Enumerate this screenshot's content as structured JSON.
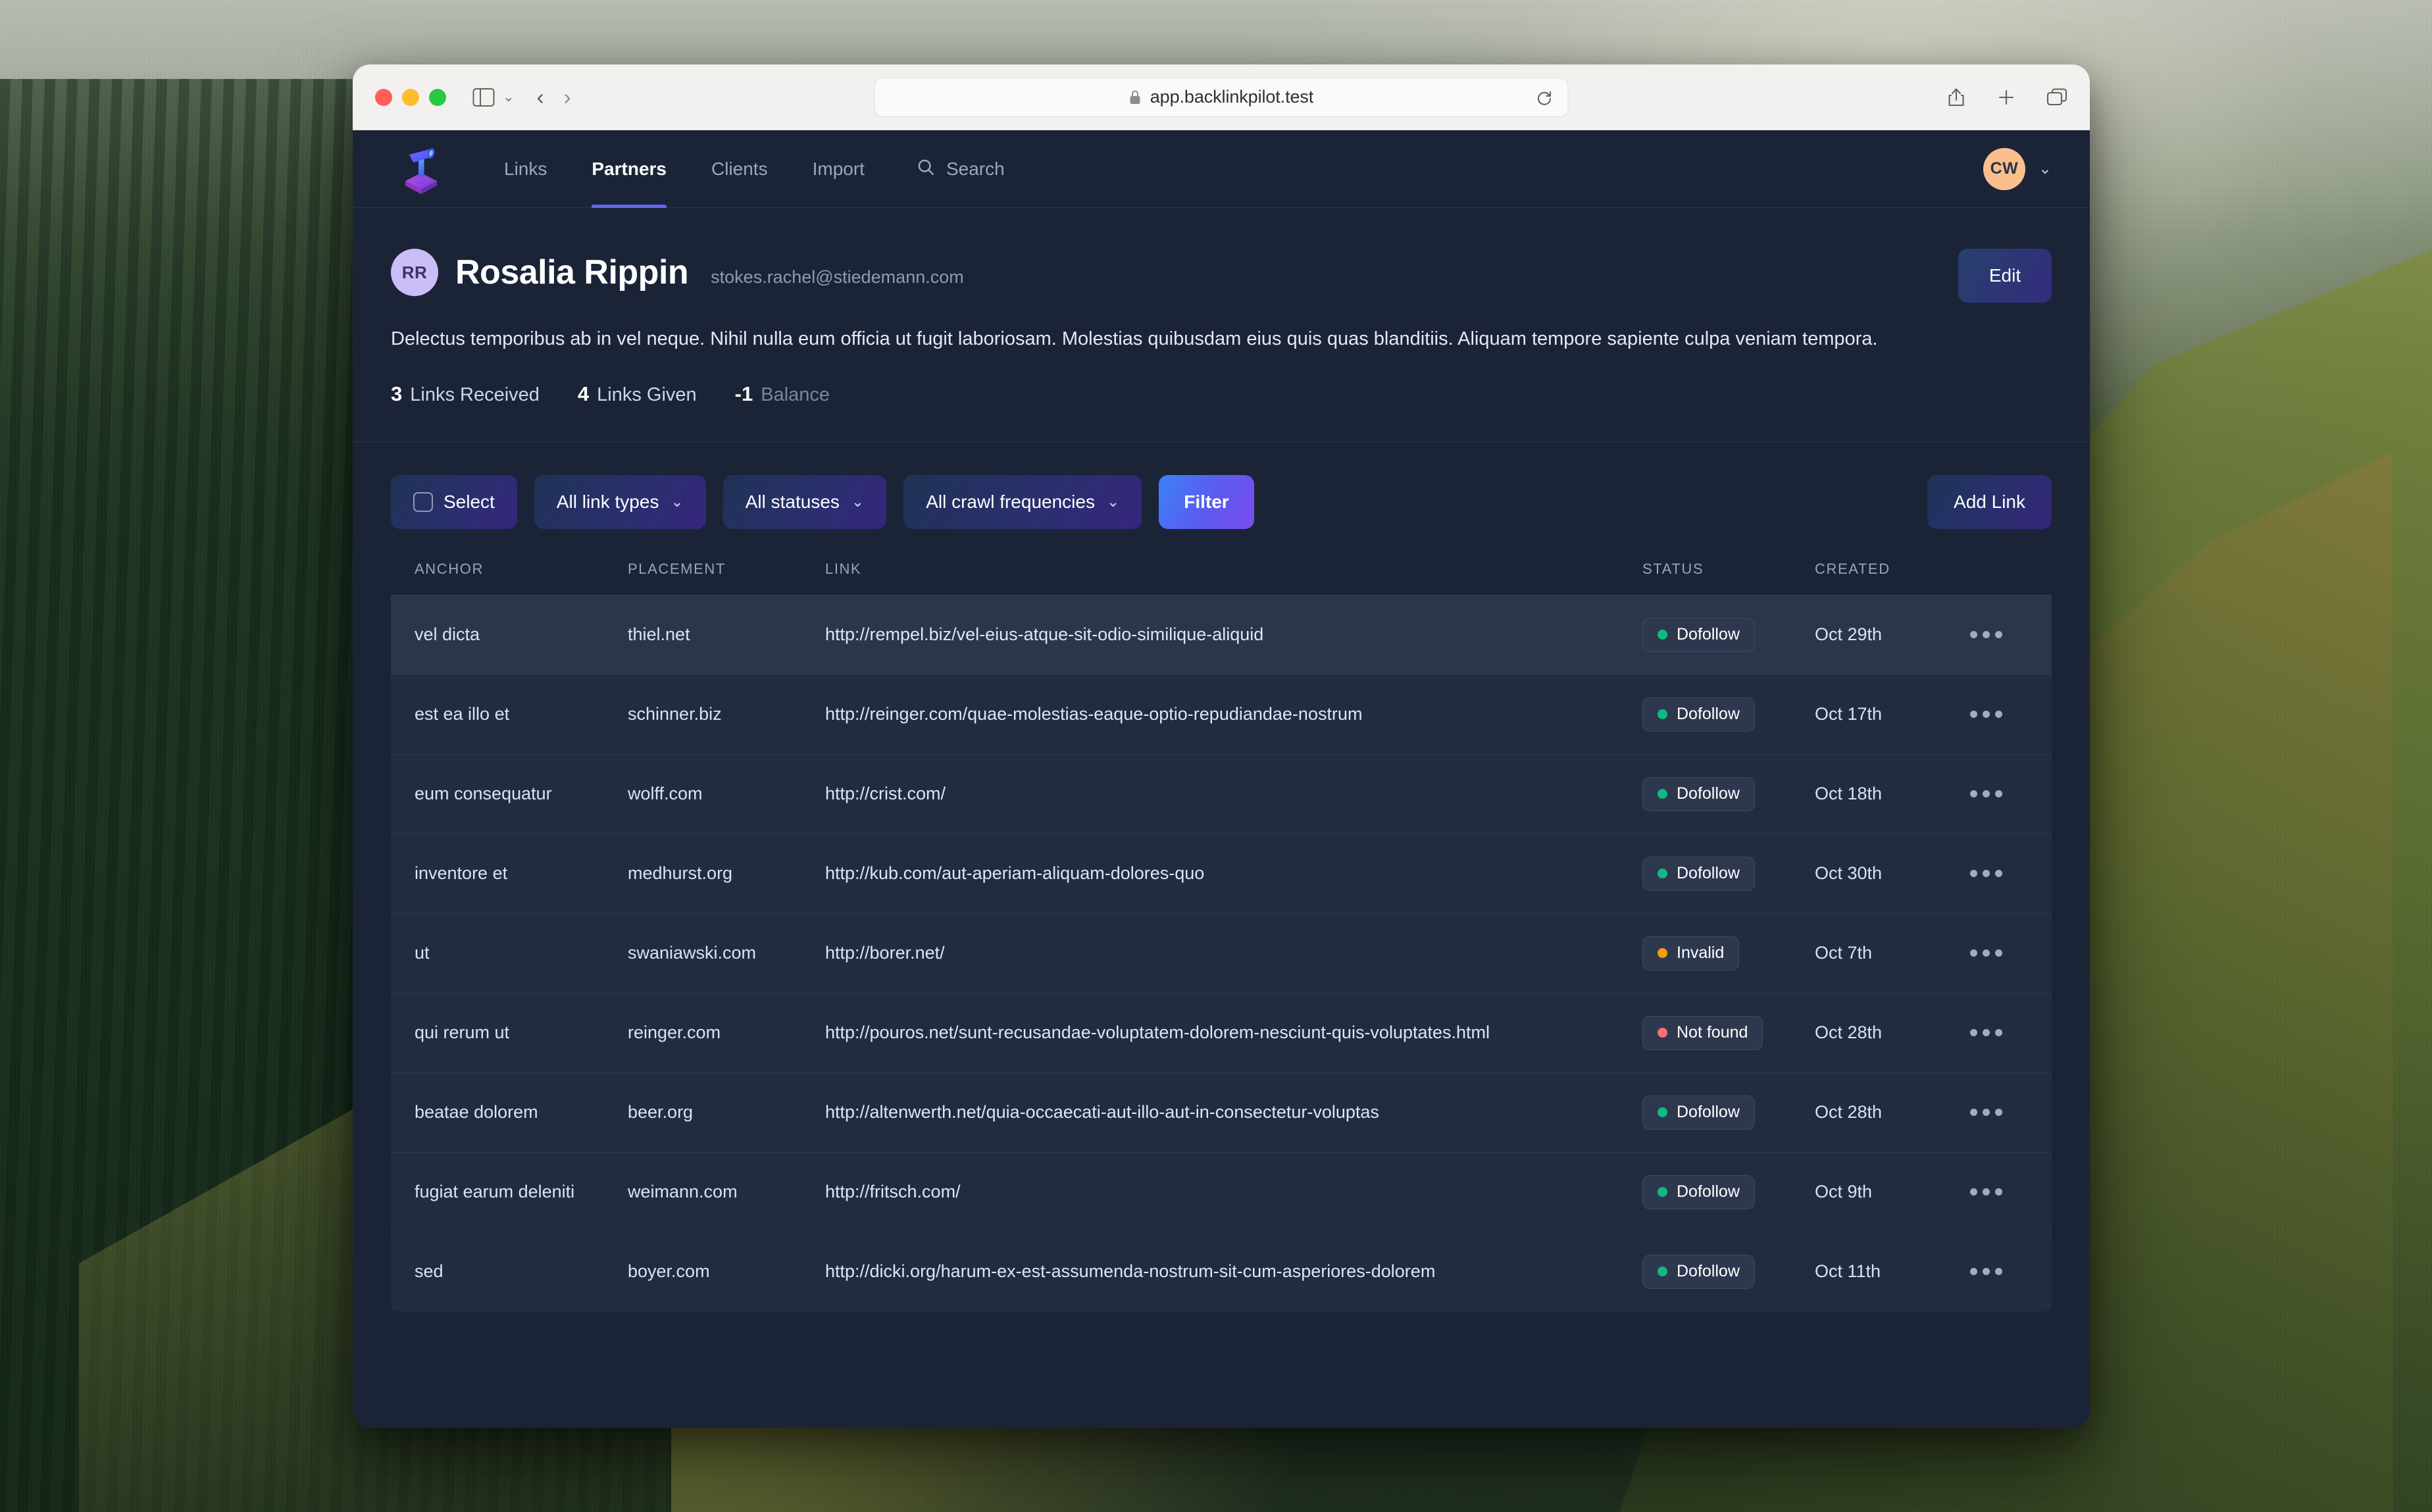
{
  "browser": {
    "url": "app.backlinkpilot.test",
    "lock_icon": "lock-icon",
    "reload_icon": "reload-icon",
    "back_icon": "chevron-left-icon",
    "forward_icon": "chevron-right-icon",
    "sidebar_icon": "sidebar-toggle-icon",
    "share_icon": "share-icon",
    "new_tab_icon": "plus-icon",
    "tabs_icon": "tab-overview-icon"
  },
  "nav": {
    "logo_name": "backlinkpilot-logo",
    "links": [
      {
        "label": "Links",
        "active": false
      },
      {
        "label": "Partners",
        "active": true
      },
      {
        "label": "Clients",
        "active": false
      },
      {
        "label": "Import",
        "active": false
      }
    ],
    "search_label": "Search",
    "search_icon": "search-icon",
    "avatar_initials": "CW",
    "avatar_color": "#fbbf8e",
    "chevron_icon": "chevron-down-icon"
  },
  "profile": {
    "initials": "RR",
    "name": "Rosalia Rippin",
    "email": "stokes.rachel@stiedemann.com",
    "edit_label": "Edit",
    "bio": "Delectus temporibus ab in vel neque. Nihil nulla eum officia ut fugit laboriosam. Molestias quibusdam eius quis quas blanditiis. Aliquam tempore sapiente culpa veniam tempora.",
    "stats": [
      {
        "num": "3",
        "label": "Links Received",
        "muted": false
      },
      {
        "num": "4",
        "label": "Links Given",
        "muted": false
      },
      {
        "num": "-1",
        "label": "Balance",
        "muted": true
      }
    ]
  },
  "toolbar": {
    "select_label": "Select",
    "link_types_label": "All link types",
    "statuses_label": "All statuses",
    "crawl_label": "All crawl frequencies",
    "filter_label": "Filter",
    "add_link_label": "Add Link",
    "chevron": "⌄"
  },
  "table": {
    "headers": {
      "anchor": "ANCHOR",
      "placement": "PLACEMENT",
      "link": "LINK",
      "status": "STATUS",
      "created": "CREATED"
    },
    "status_colors": {
      "Dofollow": "#10b981",
      "Invalid": "#f59e0b",
      "Not found": "#f87171"
    },
    "rows": [
      {
        "anchor": "vel dicta",
        "placement": "thiel.net",
        "link": "http://rempel.biz/vel-eius-atque-sit-odio-similique-aliquid",
        "status": "Dofollow",
        "created": "Oct 29th",
        "hovered": true
      },
      {
        "anchor": "est ea illo et",
        "placement": "schinner.biz",
        "link": "http://reinger.com/quae-molestias-eaque-optio-repudiandae-nostrum",
        "status": "Dofollow",
        "created": "Oct 17th",
        "hovered": false
      },
      {
        "anchor": "eum consequatur",
        "placement": "wolff.com",
        "link": "http://crist.com/",
        "status": "Dofollow",
        "created": "Oct 18th",
        "hovered": false
      },
      {
        "anchor": "inventore et",
        "placement": "medhurst.org",
        "link": "http://kub.com/aut-aperiam-aliquam-dolores-quo",
        "status": "Dofollow",
        "created": "Oct 30th",
        "hovered": false
      },
      {
        "anchor": "ut",
        "placement": "swaniawski.com",
        "link": "http://borer.net/",
        "status": "Invalid",
        "created": "Oct 7th",
        "hovered": false
      },
      {
        "anchor": "qui rerum ut",
        "placement": "reinger.com",
        "link": "http://pouros.net/sunt-recusandae-voluptatem-dolorem-nesciunt-quis-voluptates.html",
        "status": "Not found",
        "created": "Oct 28th",
        "hovered": false
      },
      {
        "anchor": "beatae dolorem",
        "placement": "beer.org",
        "link": "http://altenwerth.net/quia-occaecati-aut-illo-aut-in-consectetur-voluptas",
        "status": "Dofollow",
        "created": "Oct 28th",
        "hovered": false
      },
      {
        "anchor": "fugiat earum deleniti",
        "placement": "weimann.com",
        "link": "http://fritsch.com/",
        "status": "Dofollow",
        "created": "Oct 9th",
        "hovered": false
      },
      {
        "anchor": "sed",
        "placement": "boyer.com",
        "link": "http://dicki.org/harum-ex-est-assumenda-nostrum-sit-cum-asperiores-dolorem",
        "status": "Dofollow",
        "created": "Oct 11th",
        "hovered": false
      }
    ]
  }
}
